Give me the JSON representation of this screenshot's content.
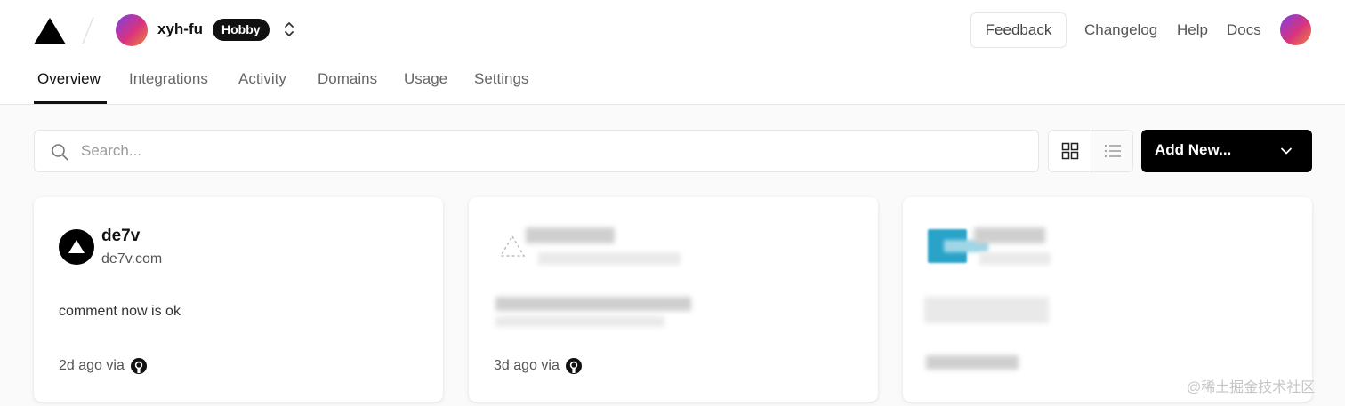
{
  "header": {
    "team_name": "xyh-fu",
    "plan_badge": "Hobby",
    "links": {
      "feedback": "Feedback",
      "changelog": "Changelog",
      "help": "Help",
      "docs": "Docs"
    }
  },
  "tabs": [
    "Overview",
    "Integrations",
    "Activity",
    "Domains",
    "Usage",
    "Settings"
  ],
  "active_tab": "Overview",
  "toolbar": {
    "search_placeholder": "Search...",
    "add_new_label": "Add New..."
  },
  "projects": [
    {
      "title": "de7v",
      "domain": "de7v.com",
      "commit_message": "comment now is ok",
      "updated": "2d ago via",
      "source_icon": "github-icon"
    },
    {
      "title": "",
      "domain": "",
      "commit_message": "",
      "updated": "3d ago via",
      "source_icon": "github-icon",
      "blurred": true
    },
    {
      "title": "",
      "domain": "",
      "commit_message": "",
      "updated": "",
      "blurred": true
    }
  ],
  "watermark": "@稀土掘金技术社区",
  "colors": {
    "primary": "#000000",
    "accent_gradient": [
      "#7b3fe4",
      "#d8337f",
      "#f0843a"
    ]
  }
}
